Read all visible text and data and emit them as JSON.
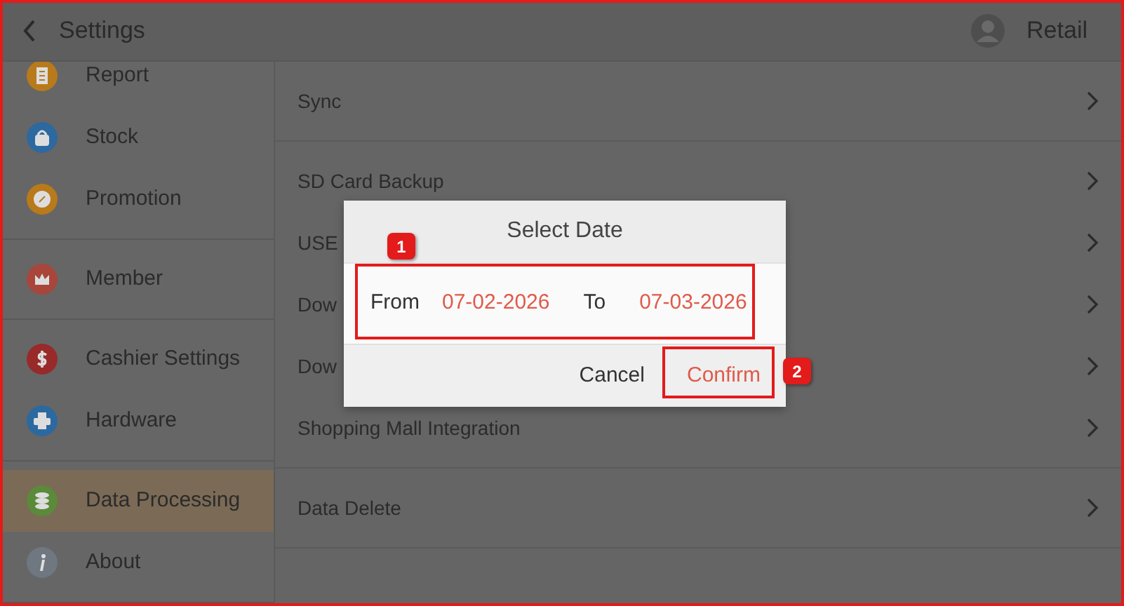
{
  "header": {
    "title": "Settings",
    "user": "Retail"
  },
  "sidebar": {
    "groups": [
      {
        "items": [
          {
            "label": "Report",
            "color": "#b87a1a",
            "selected": false
          },
          {
            "label": "Stock",
            "color": "#2c69a0",
            "selected": false
          },
          {
            "label": "Promotion",
            "color": "#b87a1a",
            "selected": false
          }
        ]
      },
      {
        "items": [
          {
            "label": "Member",
            "color": "#a8463c",
            "selected": false
          }
        ]
      },
      {
        "items": [
          {
            "label": "Cashier Settings",
            "color": "#982a2a",
            "selected": false
          },
          {
            "label": "Hardware",
            "color": "#2c69a0",
            "selected": false
          }
        ]
      },
      {
        "items": [
          {
            "label": "Data Processing",
            "color": "#5a8a3a",
            "selected": true
          },
          {
            "label": "About",
            "color": "#6f7780",
            "selected": false
          }
        ]
      }
    ]
  },
  "content": {
    "groups": [
      {
        "items": [
          {
            "label": "Sync"
          }
        ]
      },
      {
        "items": [
          {
            "label": "SD Card Backup"
          },
          {
            "label": "USE"
          },
          {
            "label": "Dow"
          },
          {
            "label": "Dow"
          },
          {
            "label": "Shopping Mall Integration"
          }
        ]
      },
      {
        "items": [
          {
            "label": "Data Delete"
          }
        ]
      }
    ]
  },
  "dialog": {
    "title": "Select Date",
    "from_label": "From",
    "from_date": "07-02-2026",
    "to_label": "To",
    "to_date": "07-03-2026",
    "callout": "1",
    "buttons": [
      {
        "label": "Cancel",
        "kind": "cancel"
      },
      {
        "label": "Confirm",
        "kind": "confirm",
        "callout": "2"
      }
    ]
  }
}
